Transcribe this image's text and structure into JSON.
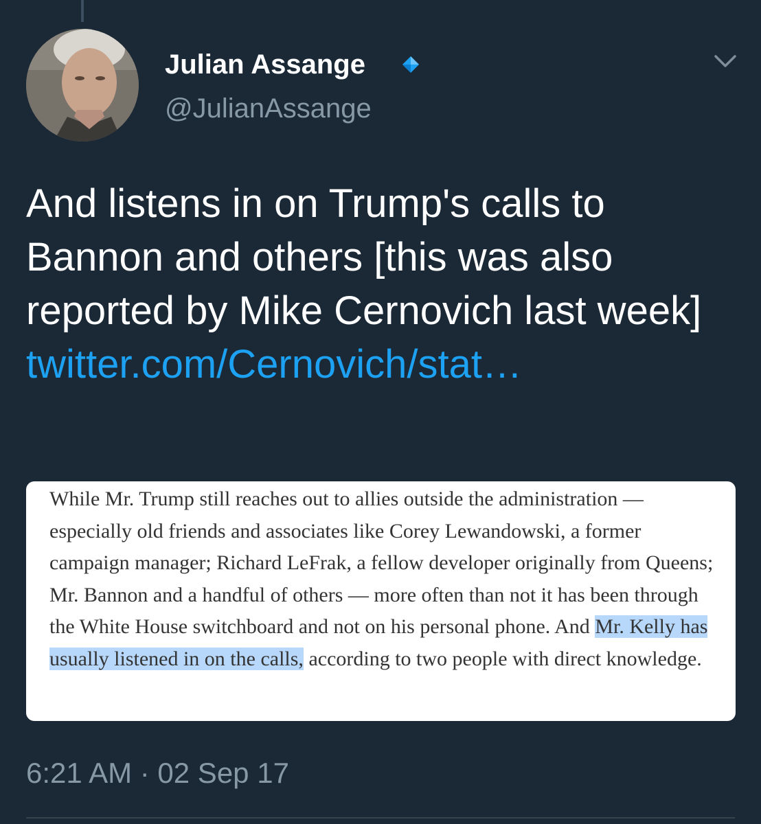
{
  "author": {
    "name": "Julian Assange",
    "handle": "@JulianAssange",
    "verified_icon": "diamond-icon",
    "verified_color": "#1da1f2"
  },
  "tweet": {
    "text": "And listens in on Trump's calls to Bannon and others [this was also reported by Mike Cernovich last week] ",
    "link": "twitter.com/Cernovich/stat…"
  },
  "quote": {
    "before": "While Mr. Trump still reaches out to allies outside the administration — especially old friends and associates like Corey Lewandowski, a former campaign manager; Richard LeFrak, a fellow developer originally from Queens; Mr. Bannon and a handful of others — more often than not it has been through the White House switchboard and not on his personal phone. And ",
    "highlighted": "Mr. Kelly has usually listened in on the calls,",
    "after": " according to two people with direct knowledge."
  },
  "meta": {
    "timestamp": "6:21 AM · 02 Sep 17"
  },
  "colors": {
    "background": "#1b2836",
    "link": "#1da1f2",
    "secondary_text": "#8899a6",
    "highlight": "#b8d8fb"
  }
}
